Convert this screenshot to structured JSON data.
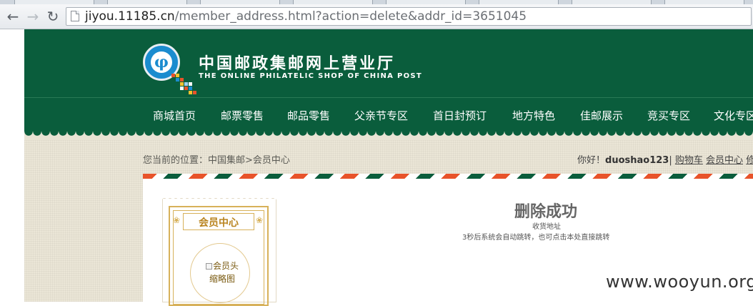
{
  "browser": {
    "url_host": "jiyou.11185.cn",
    "url_path": "/member_address.html?action=delete&addr_id=3651045",
    "back_icon": "arrow-left-icon",
    "forward_icon": "arrow-right-icon",
    "reload_icon": "reload-icon"
  },
  "header": {
    "title_cn": "中国邮政集邮网上营业厅",
    "title_en": "THE ONLINE PHILATELIC SHOP OF CHINA POST",
    "logo_glyph": "φ",
    "bg_color": "#0a5d3c"
  },
  "nav": {
    "items": [
      "商城首页",
      "邮票零售",
      "邮品零售",
      "父亲节专区",
      "首日封预订",
      "地方特色",
      "佳邮展示",
      "竞买专区",
      "文化专区"
    ]
  },
  "location": {
    "breadcrumb": "您当前的位置：中国集邮>会员中心"
  },
  "userbar": {
    "greeting": "你好！",
    "username": "duoshao123",
    "separator": "|",
    "cart": "购物车",
    "member_center": "会员中心",
    "more": "修"
  },
  "sidebar": {
    "title": "会员中心",
    "avatar_alt_line1": "会员头",
    "avatar_alt_line2": "缩略图"
  },
  "message": {
    "title": "删除成功",
    "subtitle": "收货地址",
    "redirect": "3秒后系统会自动跳转，也可点击本处直接跳转"
  },
  "watermark": "www.wooyun.org"
}
